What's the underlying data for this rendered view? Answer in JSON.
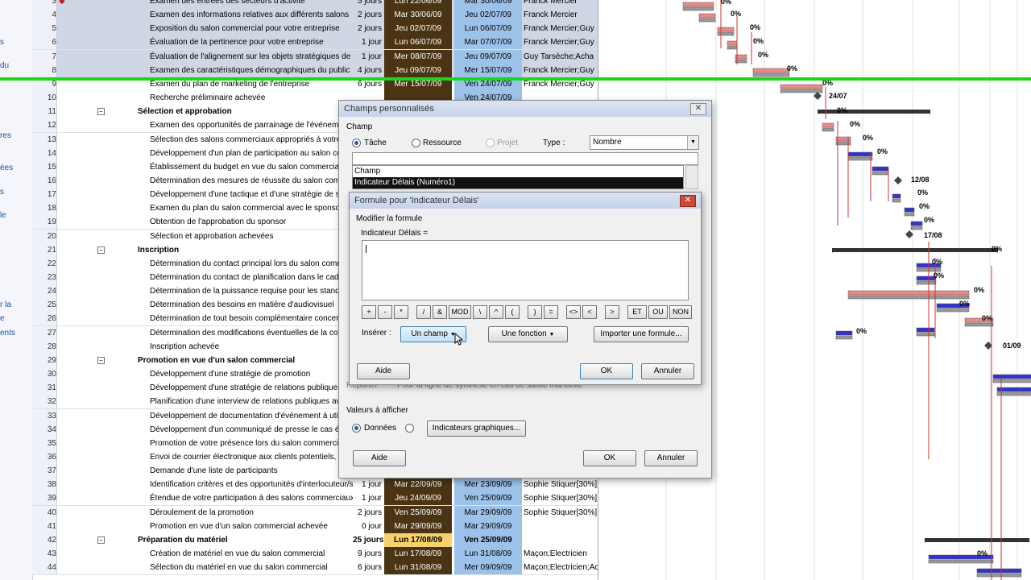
{
  "side_labels": [
    "s",
    "du",
    "res",
    "ées",
    "s",
    "le",
    "r la",
    "e",
    "ents"
  ],
  "rows": [
    {
      "id": "3",
      "name": "Examen des entrées des secteurs d'activité",
      "dur": "5 jours",
      "start": "Lun 22/06/09",
      "finish": "Mar 30/06/09",
      "res": "Franck Mercier",
      "sel": true,
      "indent": 1,
      "indicator": "◆"
    },
    {
      "id": "4",
      "name": "Examen des informations relatives aux différents salons",
      "dur": "2 jours",
      "start": "Mar 30/06/09",
      "finish": "Jeu 02/07/09",
      "res": "Franck Mercier",
      "sel": true,
      "indent": 1
    },
    {
      "id": "5",
      "name": "Exposition du salon commercial pour votre entreprise",
      "dur": "2 jours",
      "start": "Jeu 02/07/09",
      "finish": "Lun 06/07/09",
      "res": "Franck Mercier;Guy",
      "sel": true,
      "indent": 1
    },
    {
      "id": "6",
      "name": "Évaluation de la pertinence pour votre entreprise",
      "dur": "1 jour",
      "start": "Lun 06/07/09",
      "finish": "Mar 07/07/09",
      "res": "Franck Mercier;Guy",
      "sel": true,
      "indent": 1
    },
    {
      "id": "7",
      "name": "Évaluation de l'alignement sur les objets stratégiques de l",
      "dur": "1 jour",
      "start": "Mer 08/07/09",
      "finish": "Jeu 09/07/09",
      "res": "Guy Tarsèche;Acha",
      "sel": true,
      "indent": 1
    },
    {
      "id": "8",
      "name": "Examen des caractéristiques démographiques du public",
      "dur": "4 jours",
      "start": "Jeu 09/07/09",
      "finish": "Mer 15/07/09",
      "res": "Franck Mercier;Guy",
      "sel": true,
      "indent": 1
    },
    {
      "id": "9",
      "name": "Examen du plan de marketing de l'entreprise",
      "dur": "6 jours",
      "start": "Mer 15/07/09",
      "finish": "Ven 24/07/09",
      "res": "Franck Mercier;Guy",
      "indent": 1
    },
    {
      "id": "10",
      "name": "Recherche préliminaire achevée",
      "dur": "",
      "start": "",
      "finish": "Ven 24/07/09",
      "res": "",
      "indent": 1
    },
    {
      "id": "11",
      "name": "Sélection et approbation",
      "dur": "",
      "start": "",
      "finish": "",
      "res": "",
      "summary": true
    },
    {
      "id": "12",
      "name": "Examen des opportunités de parrainage de l'événement e",
      "dur": "",
      "start": "",
      "finish": "",
      "res": "",
      "indent": 1
    },
    {
      "id": "13",
      "name": "Sélection des salons commerciaux appropriés à votre en",
      "dur": "",
      "start": "",
      "finish": "",
      "res": "",
      "indent": 1
    },
    {
      "id": "14",
      "name": "Développement d'un plan de participation au salon comm",
      "dur": "",
      "start": "",
      "finish": "",
      "res": "",
      "indent": 1
    },
    {
      "id": "15",
      "name": "Établissement du budget en vue du salon commercial",
      "dur": "",
      "start": "",
      "finish": "",
      "res": "",
      "indent": 1
    },
    {
      "id": "16",
      "name": "Détermination des mesures de réussite du salon commer",
      "dur": "",
      "start": "",
      "finish": "",
      "res": "",
      "indent": 1
    },
    {
      "id": "17",
      "name": "Développement d'une tactique et d'une stratégie de suivi",
      "dur": "",
      "start": "",
      "finish": "",
      "res": "",
      "indent": 1
    },
    {
      "id": "18",
      "name": "Examen du plan du salon commercial avec le sponsor",
      "dur": "",
      "start": "",
      "finish": "",
      "res": "",
      "indent": 1
    },
    {
      "id": "19",
      "name": "Obtention de l'approbation du sponsor",
      "dur": "",
      "start": "",
      "finish": "",
      "res": "",
      "indent": 1
    },
    {
      "id": "20",
      "name": "Sélection et approbation achevées",
      "dur": "",
      "start": "",
      "finish": "",
      "res": "",
      "indent": 1
    },
    {
      "id": "21",
      "name": "Inscription",
      "dur": "",
      "start": "",
      "finish": "",
      "res": "",
      "summary": true
    },
    {
      "id": "22",
      "name": "Détermination du contact principal lors du salon commerc",
      "dur": "",
      "start": "",
      "finish": "",
      "res": "",
      "indent": 1
    },
    {
      "id": "23",
      "name": "Détermination du contact de planification dans le cadre d",
      "dur": "",
      "start": "",
      "finish": "",
      "res": "",
      "indent": 1
    },
    {
      "id": "24",
      "name": "Détermination de la puissance requise pour les stands",
      "dur": "",
      "start": "",
      "finish": "",
      "res": "",
      "indent": 1
    },
    {
      "id": "25",
      "name": "Détermination des besoins en matière d'audiovisuel",
      "dur": "",
      "start": "",
      "finish": "",
      "res": "",
      "indent": 1
    },
    {
      "id": "26",
      "name": "Détermination de tout besoin complémentaire concernant",
      "dur": "",
      "start": "",
      "finish": "",
      "res": "",
      "indent": 1
    },
    {
      "id": "27",
      "name": "Détermination des modifications éventuelles de la configu",
      "dur": "",
      "start": "",
      "finish": "",
      "res": "",
      "indent": 1
    },
    {
      "id": "28",
      "name": "Inscription achevée",
      "dur": "",
      "start": "",
      "finish": "",
      "res": "",
      "indent": 1
    },
    {
      "id": "29",
      "name": "Promotion en vue d'un salon commercial",
      "dur": "",
      "start": "",
      "finish": "",
      "res": "",
      "summary": true
    },
    {
      "id": "30",
      "name": "Développement d'une stratégie de promotion",
      "dur": "",
      "start": "",
      "finish": "",
      "res": "",
      "indent": 1
    },
    {
      "id": "31",
      "name": "Développement d'une stratégie de relations publiques",
      "dur": "",
      "start": "",
      "finish": "",
      "res": "",
      "indent": 1
    },
    {
      "id": "32",
      "name": "Planification d'une interview de relations publiques avec",
      "dur": "",
      "start": "",
      "finish": "",
      "res": "",
      "indent": 1
    },
    {
      "id": "33",
      "name": "Développement de documentation d'événement à utiliser",
      "dur": "",
      "start": "",
      "finish": "",
      "res": "",
      "indent": 1
    },
    {
      "id": "34",
      "name": "Développement d'un communiqué de presse le cas échéa",
      "dur": "",
      "start": "",
      "finish": "",
      "res": "",
      "indent": 1
    },
    {
      "id": "35",
      "name": "Promotion de votre présence lors du salon commercial",
      "dur": "",
      "start": "",
      "finish": "",
      "res": "",
      "indent": 1
    },
    {
      "id": "36",
      "name": "Envoi de courrier électronique aux clients potentiels, liste",
      "dur": "",
      "start": "",
      "finish": "",
      "res": "",
      "indent": 1
    },
    {
      "id": "37",
      "name": "Demande d'une liste de participants",
      "dur": "",
      "start": "",
      "finish": "",
      "res": "",
      "indent": 1
    },
    {
      "id": "38",
      "name": "Identification critères et des opportunités d'interlocuteur/s",
      "dur": "1 jour",
      "start": "Mar 22/09/09",
      "finish": "Mer 23/09/09",
      "res": "Sophie Stiquer[30%]",
      "indent": 1
    },
    {
      "id": "39",
      "name": "Étendue de votre participation à des salons commerciaux",
      "dur": "1 jour",
      "start": "Jeu 24/09/09",
      "finish": "Ven 25/09/09",
      "res": "Sophie Stiquer[30%]",
      "indent": 1
    },
    {
      "id": "40",
      "name": "Déroulement de la promotion",
      "dur": "2 jours",
      "start": "Ven 25/09/09",
      "finish": "Mar 29/09/09",
      "res": "Sophie Stiquer[30%]",
      "indent": 1
    },
    {
      "id": "41",
      "name": "Promotion en vue d'un salon commercial achevée",
      "dur": "0 jour",
      "start": "Mar 29/09/09",
      "finish": "Mar 29/09/09",
      "res": "",
      "indent": 1
    },
    {
      "id": "42",
      "name": "Préparation du matériel",
      "dur": "25 jours",
      "start": "Lun 17/08/09",
      "finish": "Ven 25/09/09",
      "res": "",
      "summary": true
    },
    {
      "id": "43",
      "name": "Création de matériel en vue du salon commercial",
      "dur": "9 jours",
      "start": "Lun 17/08/09",
      "finish": "Lun 31/08/09",
      "res": "Maçon;Electricien",
      "indent": 1
    },
    {
      "id": "44",
      "name": "Sélection du matériel en vue du salon commercial",
      "dur": "6 jours",
      "start": "Lun 31/08/09",
      "finish": "Mer 09/09/09",
      "res": "Maçon;Electricien;Ac",
      "indent": 1
    }
  ],
  "gantt_labels": [
    {
      "t": "0%"
    },
    {
      "t": "0%"
    },
    {
      "t": "0%"
    },
    {
      "t": "0%"
    },
    {
      "t": "0%"
    },
    {
      "t": "0%"
    },
    {
      "t": "0%"
    },
    {
      "t": "24/07"
    },
    {
      "t": "0%"
    },
    {
      "t": "0%"
    },
    {
      "t": "0%"
    },
    {
      "t": "0%"
    },
    {
      "t": "12/08"
    },
    {
      "t": "0%"
    },
    {
      "t": "0%"
    },
    {
      "t": "0%"
    },
    {
      "t": "17/08"
    },
    {
      "t": "0%"
    },
    {
      "t": "0%"
    },
    {
      "t": "0%"
    },
    {
      "t": "0%"
    },
    {
      "t": "0%"
    },
    {
      "t": "0%"
    },
    {
      "t": "0%"
    },
    {
      "t": "01/09"
    },
    {
      "t": "0%"
    }
  ],
  "outer_dialog": {
    "title": "Champs personnalisés",
    "group_champ": "Champ",
    "radio_tache": "Tâche",
    "radio_ressource": "Ressource",
    "radio_projet": "Projet",
    "type_label": "Type :",
    "type_value": "Nombre",
    "list_header": "Champ",
    "list_selected": "Indicateur Délais (Numéro1)",
    "hidden_radio_partial": "Reporter",
    "hidden_text_partial": "Pour la ligne de synthèse en cas de saisie manuelle",
    "values_label": "Valeurs à afficher",
    "radio_donnees": "Données",
    "graph_button": "Indicateurs graphiques...",
    "help": "Aide",
    "ok": "OK",
    "cancel": "Annuler"
  },
  "formula_dialog": {
    "title": "Formule pour 'Indicateur Délais'",
    "modify_label": "Modifier la formule",
    "formula_label": "Indicateur Délais =",
    "formula_value": "",
    "operators": [
      "+",
      "-",
      "*",
      "/",
      "&",
      "MOD",
      "\\",
      "^",
      "(",
      ")",
      "=",
      "<>",
      "<",
      ">",
      "ET",
      "OU",
      "NON"
    ],
    "insert_label": "Insérer :",
    "field_button": "Un champ",
    "function_button": "Une fonction",
    "import_button": "Importer une formule...",
    "help": "Aide",
    "ok": "OK",
    "cancel": "Annuler"
  }
}
